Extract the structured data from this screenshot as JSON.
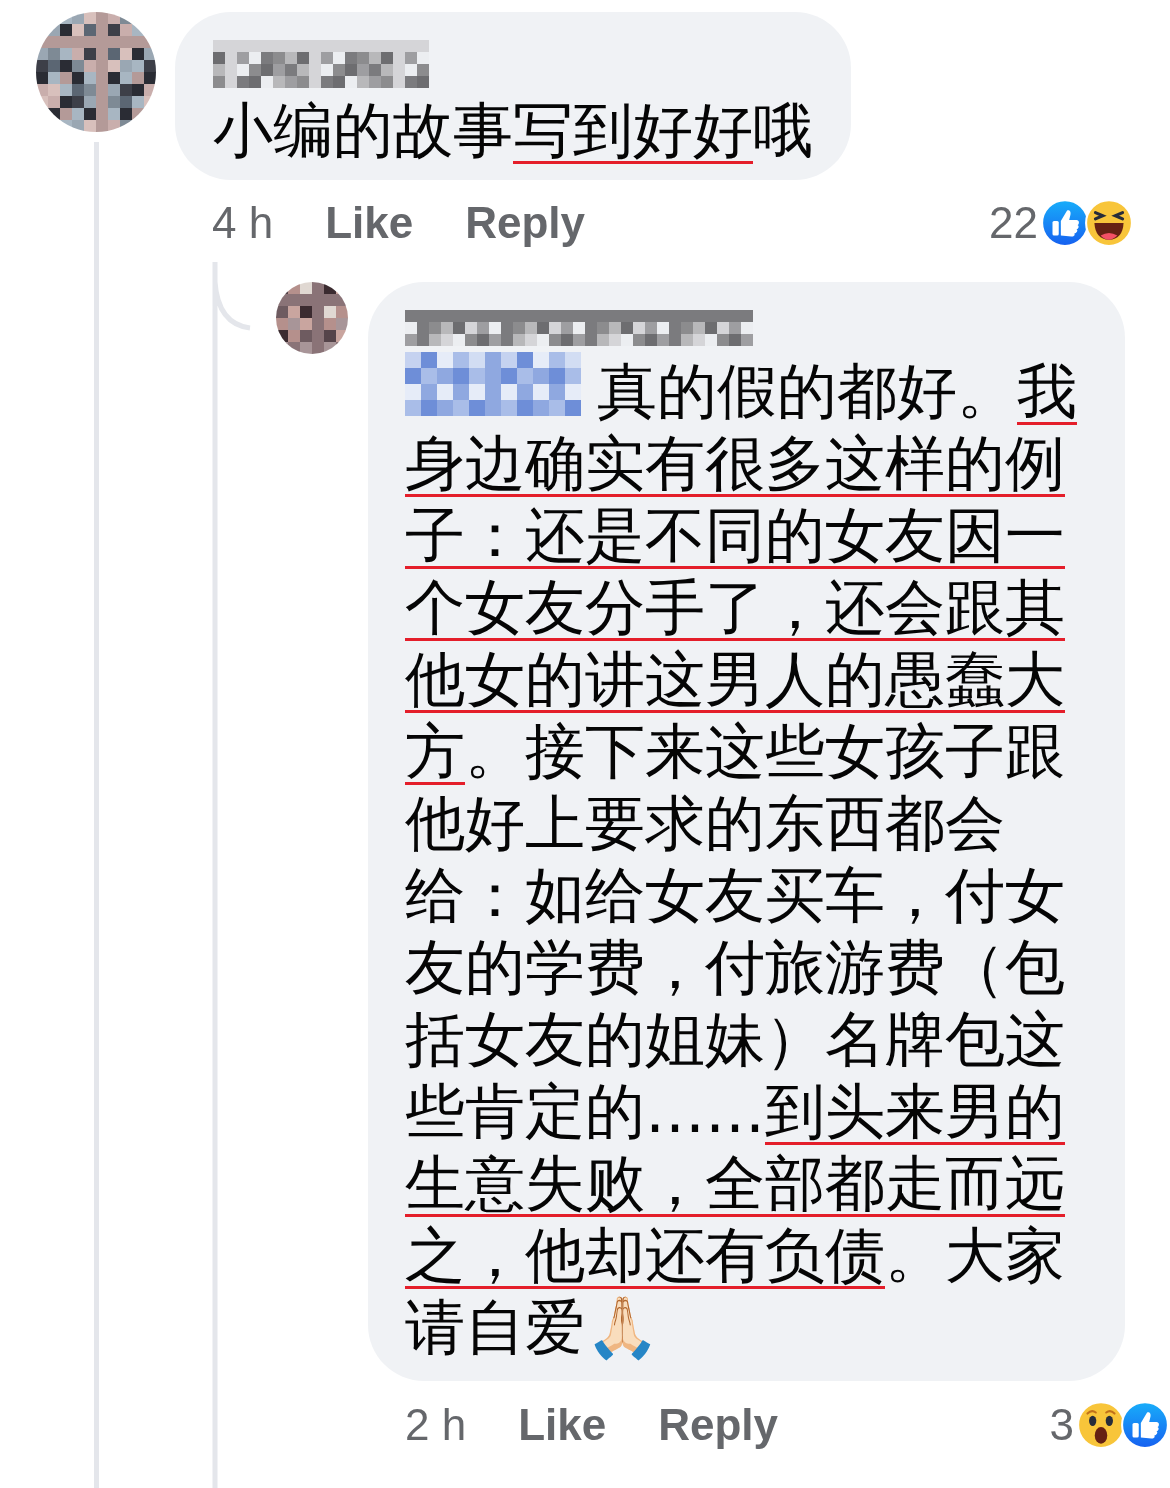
{
  "comments": [
    {
      "text_segments": [
        {
          "text": "小编的故事",
          "underlined": false
        },
        {
          "text": "写到好好",
          "underlined": true
        },
        {
          "text": "哦",
          "underlined": false
        }
      ],
      "time": "4 h",
      "like_label": "Like",
      "reply_label": "Reply",
      "reaction_count": "22",
      "reactions": [
        {
          "kind": "like"
        },
        {
          "kind": "haha"
        }
      ],
      "replies": [
        {
          "text_segments": [
            {
              "text": "真的假的都好。",
              "underlined": false
            },
            {
              "text": "我身边确实有很多这样的例子：还是不同的女友因一个女友分手了，还会跟其他女的讲这男人的愚蠢大方",
              "underlined": true
            },
            {
              "text": "。接下来这些女孩子跟他好上要求的东西都会给：如给女友买车，付女友的学费，付旅游费（包括女友的姐妹）名牌包这些肯定的……",
              "underlined": false
            },
            {
              "text": "到头来男的生意失败，全部都走而远之，他却还有负债",
              "underlined": true
            },
            {
              "text": "。大家请自爱🙏🏻",
              "underlined": false
            }
          ],
          "time": "2 h",
          "like_label": "Like",
          "reply_label": "Reply",
          "reaction_count": "3",
          "reactions": [
            {
              "kind": "wow"
            },
            {
              "kind": "like"
            }
          ]
        }
      ]
    }
  ]
}
